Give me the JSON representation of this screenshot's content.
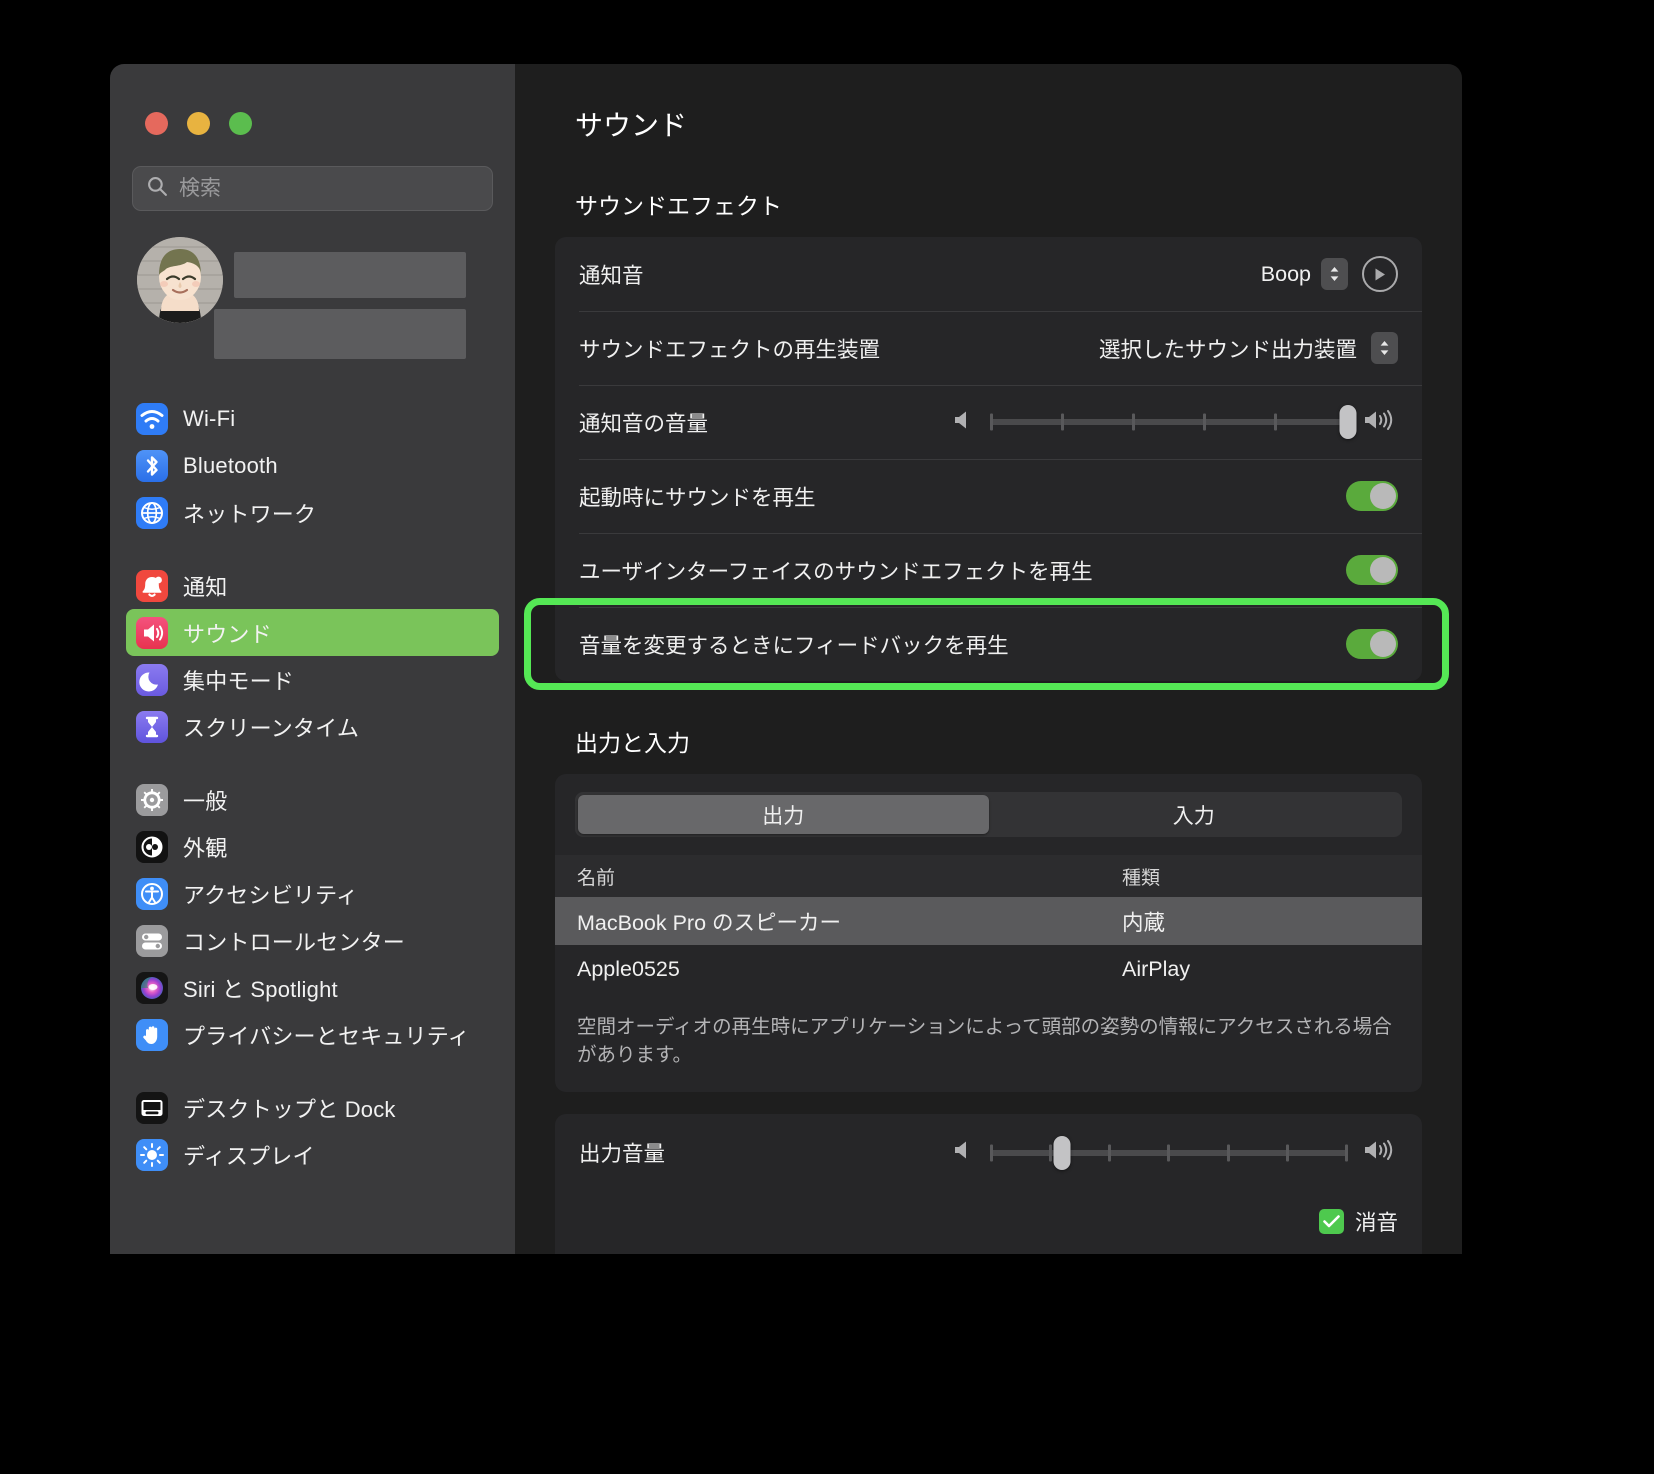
{
  "window": {
    "traffic_lights": [
      "close",
      "minimize",
      "maximize"
    ]
  },
  "sidebar": {
    "search": {
      "placeholder": "検索",
      "value": "",
      "icon": "search-icon"
    },
    "account": {
      "name_redacted": true,
      "avatar": "user-avatar"
    },
    "groups": [
      {
        "items": [
          {
            "label": "Wi-Fi",
            "icon": "wifi-icon",
            "selected": false
          },
          {
            "label": "Bluetooth",
            "icon": "bluetooth-icon",
            "selected": false
          },
          {
            "label": "ネットワーク",
            "icon": "network-globe-icon",
            "selected": false
          }
        ]
      },
      {
        "items": [
          {
            "label": "通知",
            "icon": "notifications-bell-icon",
            "selected": false
          },
          {
            "label": "サウンド",
            "icon": "sound-speaker-icon",
            "selected": true
          },
          {
            "label": "集中モード",
            "icon": "focus-moon-icon",
            "selected": false
          },
          {
            "label": "スクリーンタイム",
            "icon": "screen-time-hourglass-icon",
            "selected": false
          }
        ]
      },
      {
        "items": [
          {
            "label": "一般",
            "icon": "general-gear-icon",
            "selected": false
          },
          {
            "label": "外観",
            "icon": "appearance-contrast-icon",
            "selected": false
          },
          {
            "label": "アクセシビリティ",
            "icon": "accessibility-icon",
            "selected": false
          },
          {
            "label": "コントロールセンター",
            "icon": "control-center-icon",
            "selected": false
          },
          {
            "label": "Siri と Spotlight",
            "icon": "siri-icon",
            "selected": false
          },
          {
            "label": "プライバシーとセキュリティ",
            "icon": "privacy-hand-icon",
            "selected": false
          }
        ]
      },
      {
        "items": [
          {
            "label": "デスクトップと Dock",
            "icon": "desktop-dock-icon",
            "selected": false
          },
          {
            "label": "ディスプレイ",
            "icon": "display-icon",
            "selected": false
          }
        ]
      }
    ]
  },
  "main": {
    "title": "サウンド",
    "sound_effects": {
      "heading": "サウンドエフェクト",
      "alert_sound": {
        "label": "通知音",
        "value": "Boop",
        "play_button": "play-icon"
      },
      "effects_device": {
        "label": "サウンドエフェクトの再生装置",
        "value": "選択したサウンド出力装置"
      },
      "alert_volume": {
        "label": "通知音の音量",
        "percent": 100,
        "ticks": 6,
        "min_icon": "speaker-min-icon",
        "max_icon": "speaker-max-icon"
      },
      "toggles": [
        {
          "label": "起動時にサウンドを再生",
          "on": true
        },
        {
          "label": "ユーザインターフェイスのサウンドエフェクトを再生",
          "on": true
        },
        {
          "label": "音量を変更するときにフィードバックを再生",
          "on": true,
          "highlighted": true
        }
      ]
    },
    "output_input": {
      "heading": "出力と入力",
      "tabs": [
        {
          "label": "出力",
          "active": true
        },
        {
          "label": "入力",
          "active": false
        }
      ],
      "table": {
        "columns": [
          "名前",
          "種類"
        ],
        "rows": [
          {
            "name": "MacBook Pro のスピーカー",
            "kind": "内蔵",
            "selected": true
          },
          {
            "name": "Apple0525",
            "kind": "AirPlay",
            "selected": false
          }
        ]
      },
      "note": "空間オーディオの再生時にアプリケーションによって頭部の姿勢の情報にアクセスされる場合があります。"
    },
    "output_volume": {
      "label": "出力音量",
      "percent": 20,
      "ticks": 7,
      "mute": {
        "label": "消音",
        "checked": true
      }
    }
  },
  "annotation": {
    "color": "#55e855",
    "targets": [
      "sidebar-item-サウンド",
      "row-音量を変更するときにフィードバックを再生"
    ]
  }
}
